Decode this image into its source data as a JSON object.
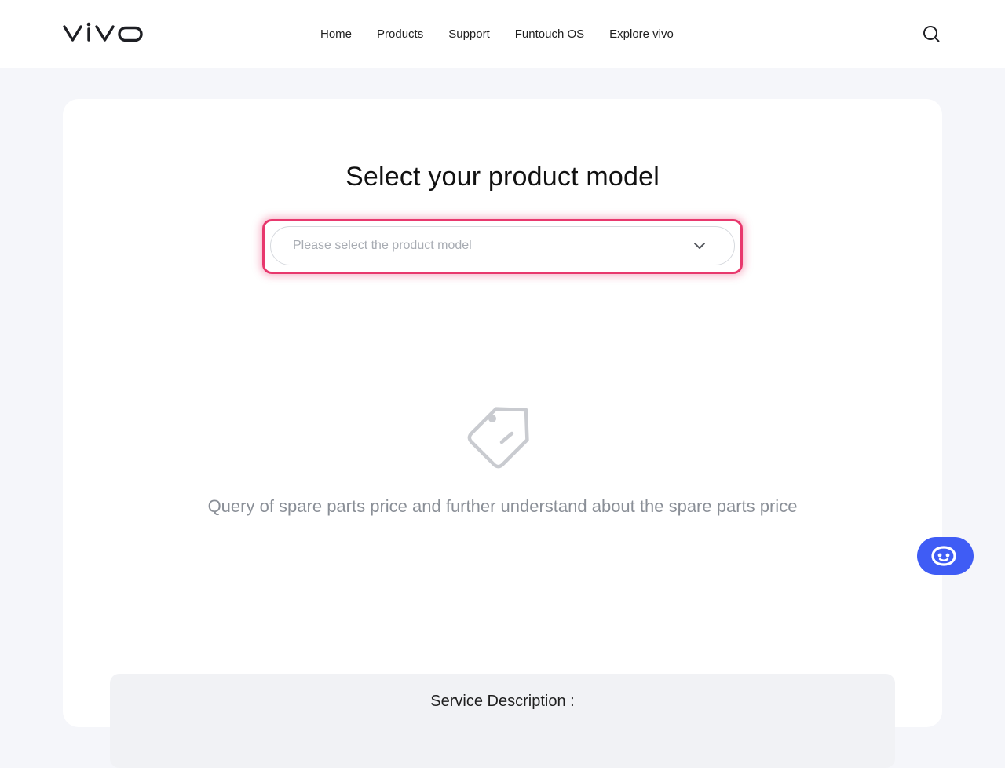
{
  "brand": {
    "logo_text": "vivo",
    "accent_color": "#3f5cf5",
    "highlight_color": "#e8386d"
  },
  "nav": {
    "items": [
      "Home",
      "Products",
      "Support",
      "Funtouch OS",
      "Explore vivo"
    ]
  },
  "header": {
    "search_icon": "search-icon"
  },
  "main": {
    "title": "Select your product model",
    "select": {
      "placeholder": "Please select the product model",
      "icon": "chevron-down-icon"
    },
    "empty_state": {
      "icon": "price-tag-icon",
      "text": "Query of spare parts price and further understand about the spare parts price"
    },
    "service": {
      "title": "Service Description :"
    }
  },
  "chat": {
    "icon": "chat-bot-icon"
  }
}
